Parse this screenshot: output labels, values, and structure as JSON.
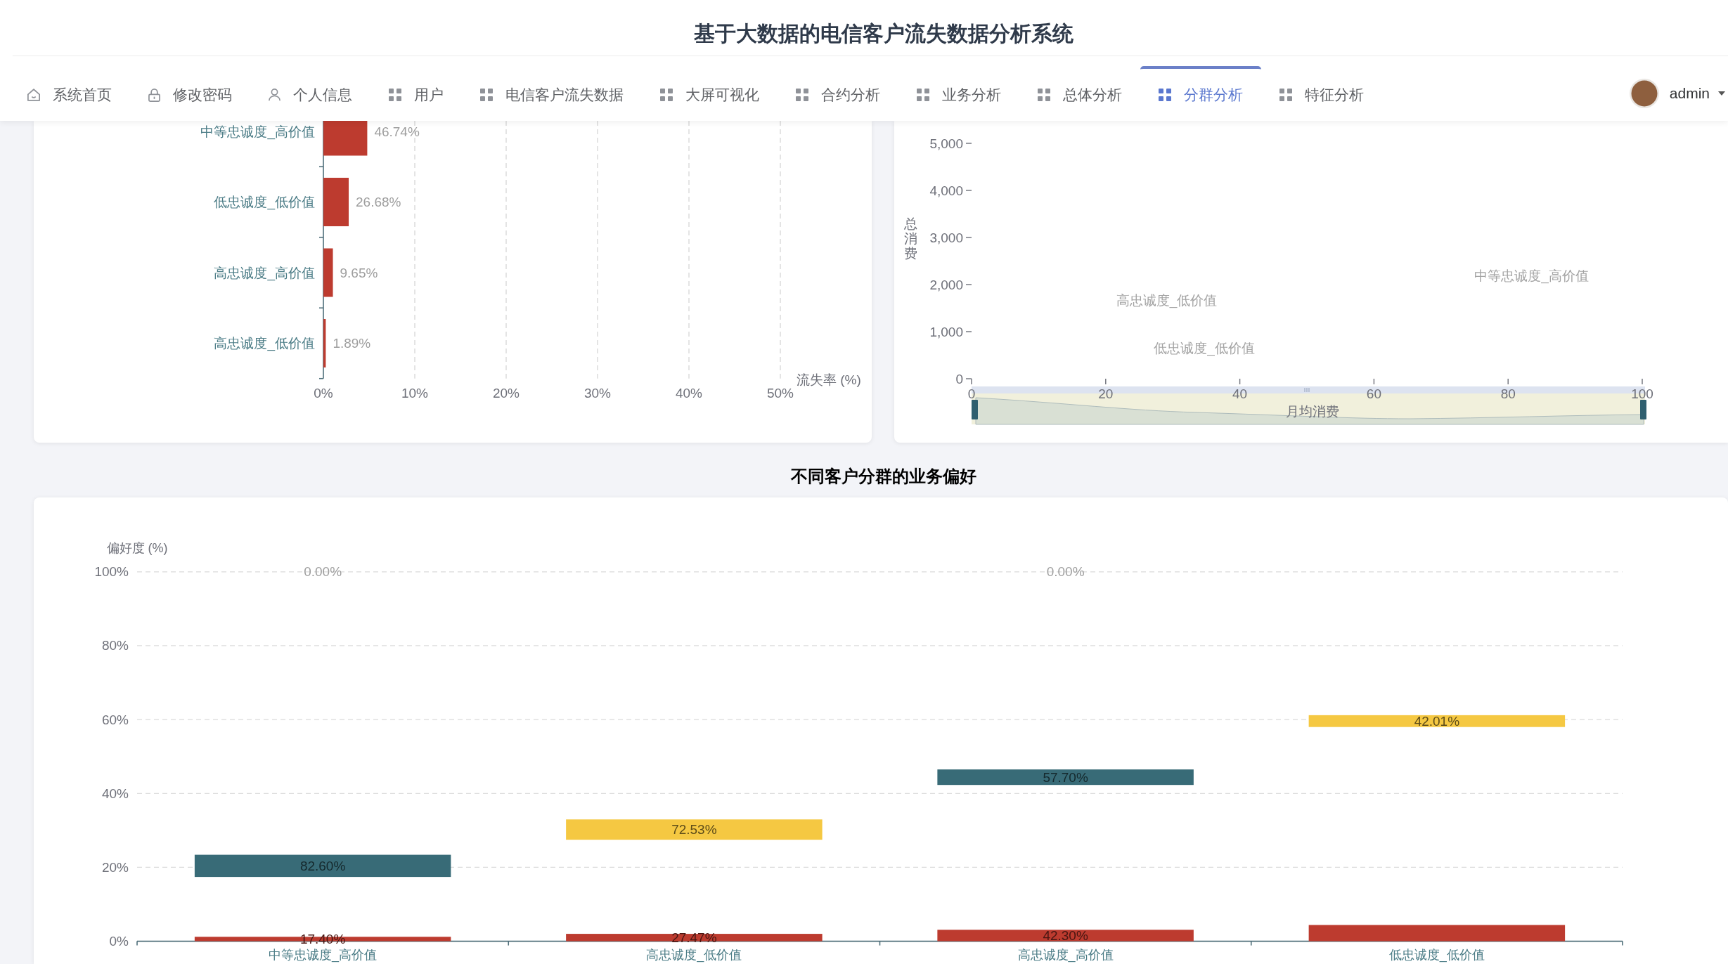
{
  "header": {
    "title": "基于大数据的电信客户流失数据分析系统"
  },
  "nav": {
    "items": [
      {
        "label": "系统首页",
        "kind": "home",
        "selected": false
      },
      {
        "label": "修改密码",
        "kind": "lock",
        "selected": false
      },
      {
        "label": "个人信息",
        "kind": "user",
        "selected": false
      },
      {
        "label": "用户",
        "kind": "grid",
        "selected": false
      },
      {
        "label": "电信客户流失数据",
        "kind": "grid",
        "selected": false
      },
      {
        "label": "大屏可视化",
        "kind": "grid",
        "selected": false
      },
      {
        "label": "合约分析",
        "kind": "grid",
        "selected": false
      },
      {
        "label": "业务分析",
        "kind": "grid",
        "selected": false
      },
      {
        "label": "总体分析",
        "kind": "grid",
        "selected": false
      },
      {
        "label": "分群分析",
        "kind": "grid",
        "selected": true
      },
      {
        "label": "特征分析",
        "kind": "grid",
        "selected": false
      }
    ],
    "user": {
      "name": "admin"
    }
  },
  "churn_chart": {
    "chart_data": {
      "type": "bar",
      "orientation": "horizontal",
      "grid": true,
      "xlabel": "流失率 (%)",
      "categories": [
        "中等忠诚度_高价值",
        "低忠诚度_低价值",
        "高忠诚度_高价值",
        "高忠诚度_低价值"
      ],
      "series": [
        {
          "color": "#bd3b2f",
          "values": [
            4.8,
            2.77,
            1.04,
            0.26
          ]
        }
      ],
      "xlim": [
        0,
        50
      ],
      "xticks": [
        {
          "value": 0,
          "label": "0%"
        },
        {
          "value": 10,
          "label": "10%"
        },
        {
          "value": 20,
          "label": "20%"
        },
        {
          "value": 30,
          "label": "30%"
        },
        {
          "value": 40,
          "label": "40%"
        },
        {
          "value": 50,
          "label": "50%"
        }
      ],
      "annotations": [
        "46.74%",
        "26.68%",
        "9.65%",
        "1.89%"
      ]
    }
  },
  "segment_chart": {
    "chart_data": {
      "type": "scatter",
      "xlabel": "月均消费",
      "ylabel": "总消费",
      "xlim": [
        0,
        100
      ],
      "ylim": [
        0,
        5000
      ],
      "xticks": [
        0,
        20,
        40,
        60,
        80,
        100
      ],
      "yticks": [
        {
          "value": 0,
          "label": "0"
        },
        {
          "value": 1000,
          "label": "1,000"
        },
        {
          "value": 2000,
          "label": "2,000"
        },
        {
          "value": 3000,
          "label": "3,000"
        },
        {
          "value": 4000,
          "label": "4,000"
        },
        {
          "value": 5000,
          "label": "5,000"
        }
      ],
      "annotations": [
        "中等忠诚度_高价值",
        "高忠诚度_低价值",
        "低忠诚度_低价值"
      ]
    }
  },
  "preference_chart": {
    "chart_data": {
      "type": "bar",
      "orientation": "vertical",
      "stacked": false,
      "grid": true,
      "title": "不同客户分群的业务偏好",
      "ylabel": "偏好度 (%)",
      "categories": [
        "中等忠诚度_高价值",
        "高忠诚度_低价值",
        "高忠诚度_高价值",
        "低忠诚度_低价值"
      ],
      "ylim": [
        0,
        100
      ],
      "yticks": [
        {
          "value": 0,
          "label": "0%"
        },
        {
          "value": 20,
          "label": "20%"
        },
        {
          "value": 40,
          "label": "40%"
        },
        {
          "value": 60,
          "label": "60%"
        },
        {
          "value": 80,
          "label": "80%"
        },
        {
          "value": 100,
          "label": "100%"
        }
      ],
      "series": [
        {
          "color": "#bd3b2f",
          "base": [
            0,
            0,
            0,
            0
          ],
          "values": [
            1.2,
            2.0,
            3.1,
            4.4
          ]
        },
        {
          "color": "#386b77",
          "base": [
            17.4,
            null,
            42.3,
            null
          ],
          "values": [
            6.0,
            null,
            4.2,
            null
          ]
        },
        {
          "color": "#f5c842",
          "base": [
            null,
            27.47,
            null,
            57.99
          ],
          "values": [
            null,
            5.5,
            null,
            3.2
          ]
        }
      ],
      "annotations": [
        "17.40%",
        "27.47%",
        "42.30%",
        "82.60%",
        "57.70%",
        "0.00%",
        "72.53%",
        "0.00%",
        "42.01%"
      ]
    }
  }
}
